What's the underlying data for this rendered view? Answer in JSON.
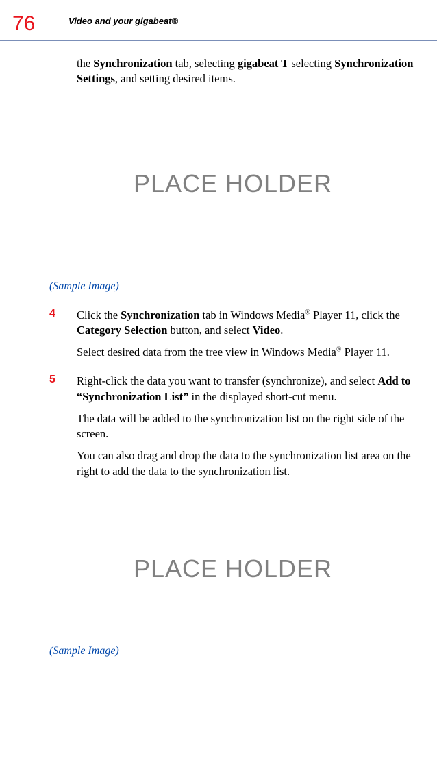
{
  "page_number": "76",
  "header_title": "Video and your gigabeat®",
  "intro_text_parts": {
    "p1": "the ",
    "p2": "Synchronization",
    "p3": " tab, selecting ",
    "p4": "gigabeat T",
    "p5": " selecting ",
    "p6": "Synchronization Settings",
    "p7": ", and setting desired items."
  },
  "placeholder1": "PLACE HOLDER",
  "sample_caption1": "(Sample Image)",
  "step4": {
    "num": "4",
    "para1_parts": {
      "p1": "Click the ",
      "p2": "Synchronization",
      "p3": " tab in Windows Media",
      "sup1": "®",
      "p4": " Player 11, click the ",
      "p5": "Category Selection",
      "p6": " button, and select ",
      "p7": "Video",
      "p8": "."
    },
    "para2_parts": {
      "p1": "Select desired data from the tree view in Windows Media",
      "sup1": "®",
      "p2": " Player 11."
    }
  },
  "step5": {
    "num": "5",
    "para1_parts": {
      "p1": "Right-click the data you want to transfer (synchronize), and select ",
      "p2": "Add to “Synchronization List”",
      "p3": " in the displayed short-cut menu."
    },
    "para2": "The data will be added to the synchronization list on the right side of the screen.",
    "para3": "You can also drag and drop the data to the synchronization list area on the right to add the data to the synchronization list."
  },
  "placeholder2": "PLACE HOLDER",
  "sample_caption2": "(Sample Image)"
}
